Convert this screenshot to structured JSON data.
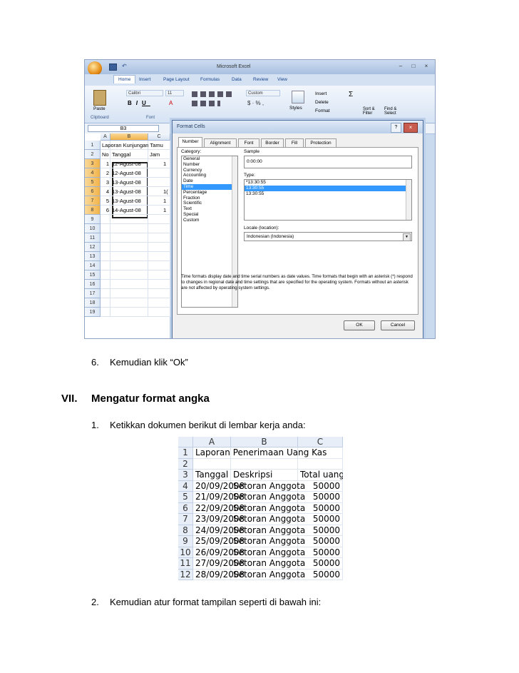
{
  "excel": {
    "window_title": "Microsoft Excel",
    "ribbon_tabs": [
      "Home",
      "Insert",
      "Page Layout",
      "Formulas",
      "Data",
      "Review",
      "View"
    ],
    "font_name": "Calibri",
    "font_size": "11",
    "number_format": "Custom",
    "clipboard_label": "Clipboard",
    "font_group_label": "Font",
    "paste_label": "Paste",
    "styles_label": "Styles",
    "insert_label": "Insert",
    "delete_label": "Delete",
    "format_label": "Format",
    "sort_label": "Sort & Filter",
    "find_label": "Find & Select",
    "name_box": "B3",
    "col_headers": [
      "A",
      "B",
      "C"
    ],
    "row_headers": [
      "1",
      "2",
      "3",
      "4",
      "5",
      "6",
      "7",
      "8",
      "9",
      "10",
      "11",
      "12",
      "13",
      "14",
      "15",
      "16",
      "17",
      "18",
      "19"
    ],
    "title_cell": "Laporan Kunjungan Tamu",
    "header_row": [
      "No",
      "Tanggal",
      "Jam"
    ],
    "rows": [
      {
        "no": "1",
        "tanggal": "12-Agust-08",
        "jam": "1"
      },
      {
        "no": "2",
        "tanggal": "12-Agust-08",
        "jam": ""
      },
      {
        "no": "3",
        "tanggal": "13-Agust-08",
        "jam": ""
      },
      {
        "no": "4",
        "tanggal": "13-Agust-08",
        "jam": "1("
      },
      {
        "no": "5",
        "tanggal": "13-Agust-08",
        "jam": "1"
      },
      {
        "no": "6",
        "tanggal": "14-Agust-08",
        "jam": "1"
      }
    ]
  },
  "dialog": {
    "title": "Format Cells",
    "tabs": [
      "Number",
      "Alignment",
      "Font",
      "Border",
      "Fill",
      "Protection"
    ],
    "category_label": "Category:",
    "categories": [
      "General",
      "Number",
      "Currency",
      "Accounting",
      "Date",
      "Time",
      "Percentage",
      "Fraction",
      "Scientific",
      "Text",
      "Special",
      "Custom"
    ],
    "selected_category": "Time",
    "sample_label": "Sample",
    "sample_value": "0:00:00",
    "type_label": "Type:",
    "types": [
      "*13:30:55",
      "13:30:55",
      "13:30:55"
    ],
    "locale_label": "Locale (location):",
    "locale_value": "Indonesian (Indonesia)",
    "description": "Time formats display date and time serial numbers as date values.  Time formats that begin with an asterisk (*) respond to changes in regional date and time settings that are specified for the operating system. Formats without an asterisk are not affected by operating system settings.",
    "ok": "OK",
    "cancel": "Cancel"
  },
  "doc": {
    "step6_num": "6.",
    "step6_text": "Kemudian klik “Ok”",
    "section_num": "VII.",
    "section_title": "Mengatur format angka",
    "step1_num": "1.",
    "step1_text": "Ketikkan dokumen berikut di lembar kerja anda:",
    "step2_num": "2.",
    "step2_text": "Kemudian atur format tampilan seperti di bawah ini:"
  },
  "sheet2": {
    "col_headers": [
      "A",
      "B",
      "C"
    ],
    "row_headers": [
      "1",
      "2",
      "3",
      "4",
      "5",
      "6",
      "7",
      "8",
      "9",
      "10",
      "11",
      "12"
    ],
    "title": "Laporan Penerimaan Uang Kas",
    "headers": [
      "Tanggal",
      "Deskripsi",
      "Total uang"
    ],
    "rows": [
      {
        "tanggal": "20/09/2008",
        "deskripsi": "Setoran Anggota",
        "total": "50000"
      },
      {
        "tanggal": "21/09/2008",
        "deskripsi": "Setoran Anggota",
        "total": "50000"
      },
      {
        "tanggal": "22/09/2008",
        "deskripsi": "Setoran Anggota",
        "total": "50000"
      },
      {
        "tanggal": "23/09/2008",
        "deskripsi": "Setoran Anggota",
        "total": "50000"
      },
      {
        "tanggal": "24/09/2008",
        "deskripsi": "Setoran Anggota",
        "total": "50000"
      },
      {
        "tanggal": "25/09/2008",
        "deskripsi": "Setoran Anggota",
        "total": "50000"
      },
      {
        "tanggal": "26/09/2008",
        "deskripsi": "Setoran Anggota",
        "total": "50000"
      },
      {
        "tanggal": "27/09/2008",
        "deskripsi": "Setoran Anggota",
        "total": "50000"
      },
      {
        "tanggal": "28/09/2008",
        "deskripsi": "Setoran Anggota",
        "total": "50000"
      }
    ]
  }
}
